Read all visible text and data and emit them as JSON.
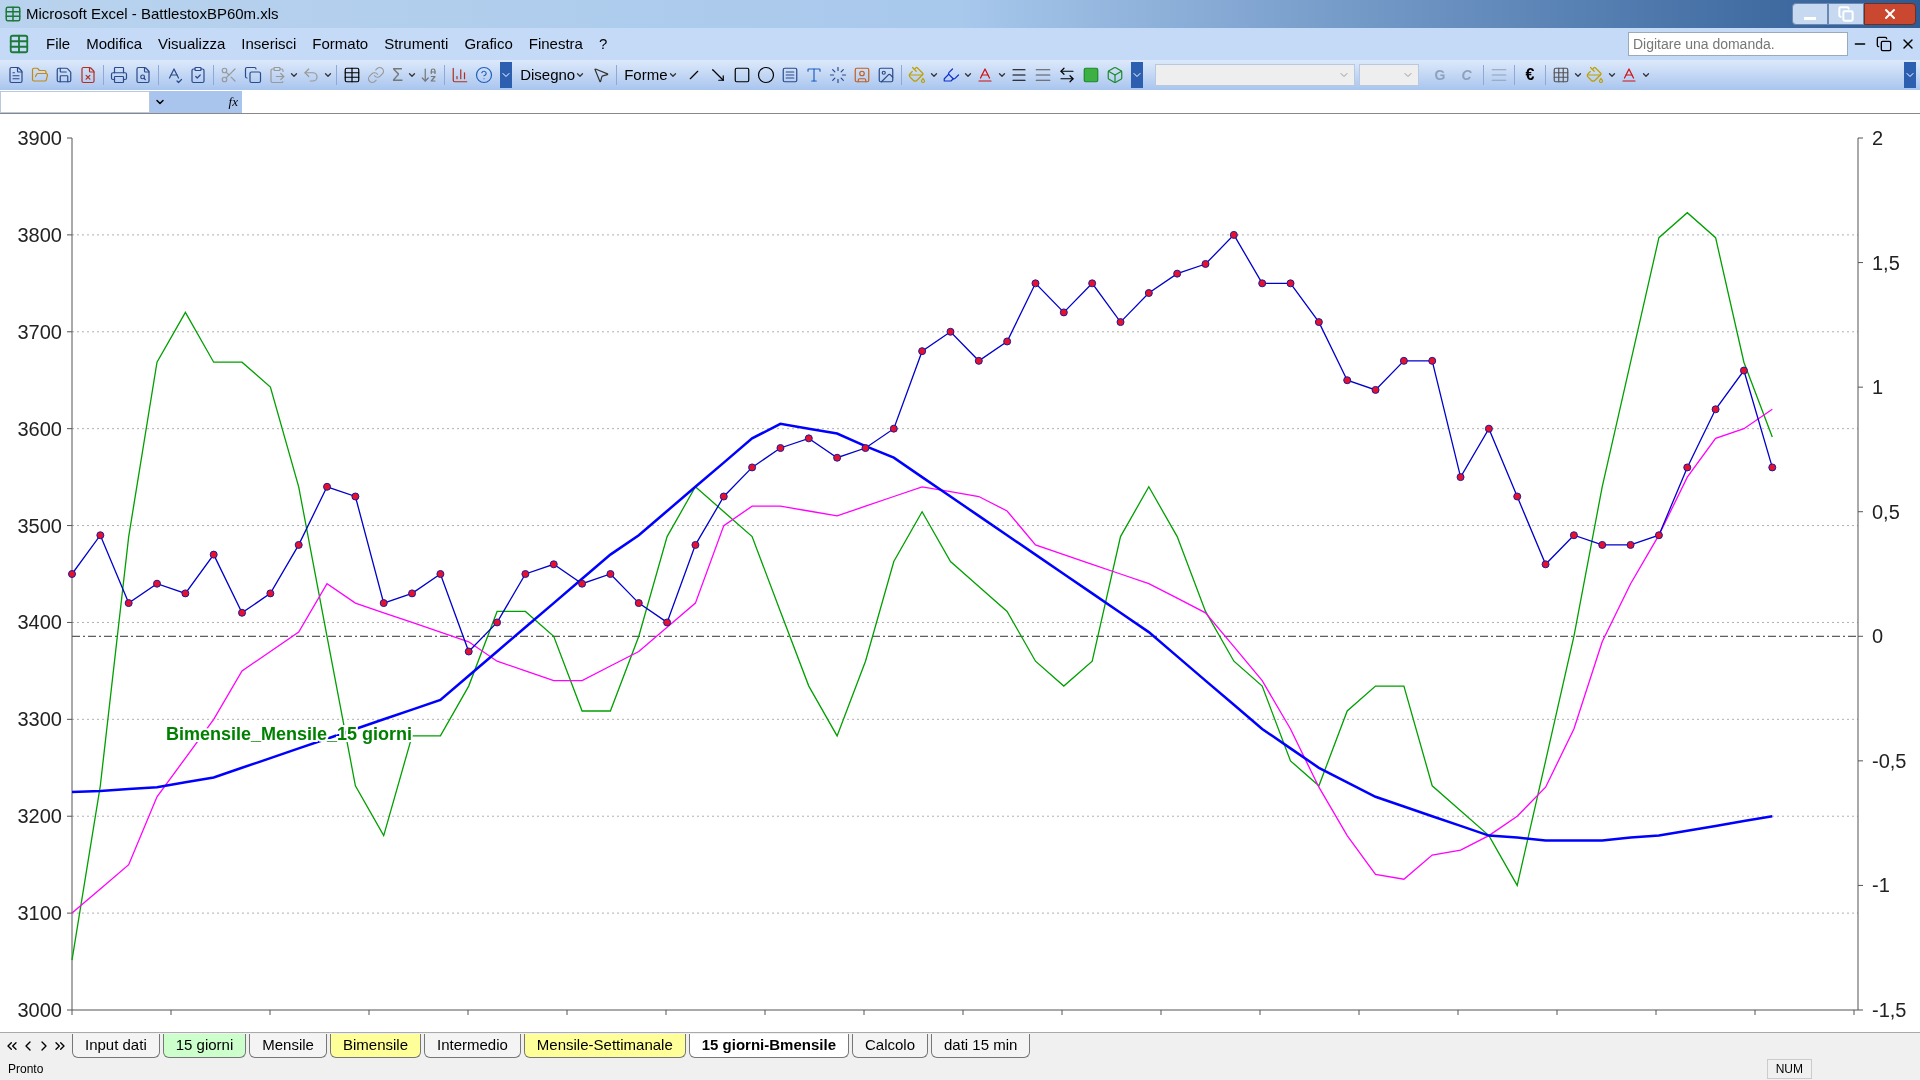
{
  "window": {
    "title": "Microsoft Excel - BattlestoxBP60m.xls"
  },
  "menu": {
    "items": [
      "File",
      "Modifica",
      "Visualizza",
      "Inserisci",
      "Formato",
      "Strumenti",
      "Grafico",
      "Finestra",
      "?"
    ]
  },
  "help_box": {
    "placeholder": "Digitare una domanda."
  },
  "toolbar": {
    "sum_glyph": "Σ",
    "drawing_menu": "Disegno",
    "shapes_menu": "Forme",
    "bold_button": "G",
    "italic_button": "C",
    "euro_button": "€"
  },
  "formula_bar": {
    "fx_label": "fx"
  },
  "chart": {
    "chart_data": {
      "type": "line",
      "grid": true,
      "ylim": [
        3000,
        3900
      ],
      "yticks": [
        3000,
        3100,
        3200,
        3300,
        3400,
        3500,
        3600,
        3700,
        3800,
        3900
      ],
      "y2lim": [
        -1.5,
        2
      ],
      "y2ticks": [
        {
          "value": -1.5,
          "label": "-1,5"
        },
        {
          "value": -1,
          "label": "-1"
        },
        {
          "value": -0.5,
          "label": "-0,5"
        },
        {
          "value": 0,
          "label": "0"
        },
        {
          "value": 0.5,
          "label": "0,5"
        },
        {
          "value": 1,
          "label": "1"
        },
        {
          "value": 1.5,
          "label": "1,5"
        },
        {
          "value": 2,
          "label": "2"
        }
      ],
      "series": [
        {
          "color": "#00a000",
          "axis": "y2",
          "values": [
            -1.3,
            -0.6,
            0.4,
            1.1,
            1.3,
            1.1,
            1.1,
            1.0,
            0.6,
            0,
            -0.6,
            -0.8,
            -0.4,
            -0.4,
            -0.2,
            0.1,
            0.1,
            0,
            -0.3,
            -0.3,
            0,
            0.4,
            0.6,
            0.5,
            0.4,
            0.1,
            -0.2,
            -0.4,
            -0.1,
            0.3,
            0.5,
            0.3,
            0.2,
            0.1,
            -0.1,
            -0.2,
            -0.1,
            0.4,
            0.6,
            0.4,
            0.1,
            -0.1,
            -0.2,
            -0.5,
            -0.6,
            -0.3,
            -0.2,
            -0.2,
            -0.6,
            -0.7,
            -0.8,
            -1.0,
            -0.5,
            0,
            0.6,
            1.1,
            1.6,
            1.7,
            1.6,
            1.1,
            0.8
          ]
        },
        {
          "color": "#ff00ff",
          "values": [
            3100,
            3125,
            3150,
            3220,
            3260,
            3300,
            3350,
            3370,
            3390,
            3440,
            3420,
            3410,
            3400,
            3390,
            3380,
            3360,
            3350,
            3340,
            3340,
            3355,
            3370,
            3395,
            3420,
            3500,
            3520,
            3520,
            3515,
            3510,
            3520,
            3530,
            3540,
            3535,
            3530,
            3515,
            3480,
            3470,
            3460,
            3450,
            3440,
            3425,
            3410,
            3375,
            3340,
            3290,
            3230,
            3180,
            3140,
            3135,
            3160,
            3165,
            3180,
            3200,
            3230,
            3290,
            3380,
            3440,
            3490,
            3550,
            3590,
            3600,
            3620
          ]
        },
        {
          "color": "#0000ff",
          "values": [
            3225,
            3226,
            3228,
            3230,
            3235,
            3240,
            3250,
            3260,
            3270,
            3280,
            3290,
            3300,
            3310,
            3320,
            3345,
            3370,
            3395,
            3420,
            3445,
            3470,
            3490,
            3515,
            3540,
            3565,
            3590,
            3605,
            3600,
            3595,
            3582,
            3570,
            3550,
            3530,
            3510,
            3490,
            3470,
            3450,
            3430,
            3410,
            3390,
            3365,
            3340,
            3315,
            3290,
            3270,
            3250,
            3235,
            3220,
            3210,
            3200,
            3190,
            3180,
            3178,
            3175,
            3175,
            3175,
            3178,
            3180,
            3185,
            3190,
            3195,
            3200
          ]
        },
        {
          "color": "#0000cc",
          "marker": true,
          "values": [
            3450,
            3490,
            3420,
            3440,
            3430,
            3470,
            3410,
            3430,
            3480,
            3540,
            3530,
            3420,
            3430,
            3450,
            3370,
            3400,
            3450,
            3460,
            3440,
            3450,
            3420,
            3400,
            3480,
            3530,
            3560,
            3580,
            3590,
            3570,
            3580,
            3600,
            3680,
            3700,
            3670,
            3690,
            3750,
            3720,
            3750,
            3710,
            3740,
            3760,
            3770,
            3800,
            3750,
            3750,
            3710,
            3650,
            3640,
            3670,
            3670,
            3550,
            3600,
            3530,
            3460,
            3490,
            3480,
            3480,
            3490,
            3560,
            3620,
            3660,
            3560
          ]
        }
      ],
      "annotations": [
        "Bimensile_Mensile_15 giorni"
      ],
      "ref_lines": [
        {
          "axis": "y2",
          "value": 0
        }
      ]
    }
  },
  "sheet_tabs": [
    {
      "label": "Input dati",
      "selected": false
    },
    {
      "label": "15 giorni",
      "selected": false,
      "color": "#ccffcc"
    },
    {
      "label": "Mensile",
      "selected": false
    },
    {
      "label": "Bimensile",
      "selected": false,
      "color": "#ffff99"
    },
    {
      "label": "Intermedio",
      "selected": false
    },
    {
      "label": "Mensile-Settimanale",
      "selected": false,
      "color": "#ffff99"
    },
    {
      "label": "15 giorni-Bmensile",
      "selected": true
    },
    {
      "label": "Calcolo",
      "selected": false
    },
    {
      "label": "dati 15 min",
      "selected": false
    }
  ],
  "status_bar": {
    "status": "Pronto",
    "num_indicator": "NUM"
  }
}
